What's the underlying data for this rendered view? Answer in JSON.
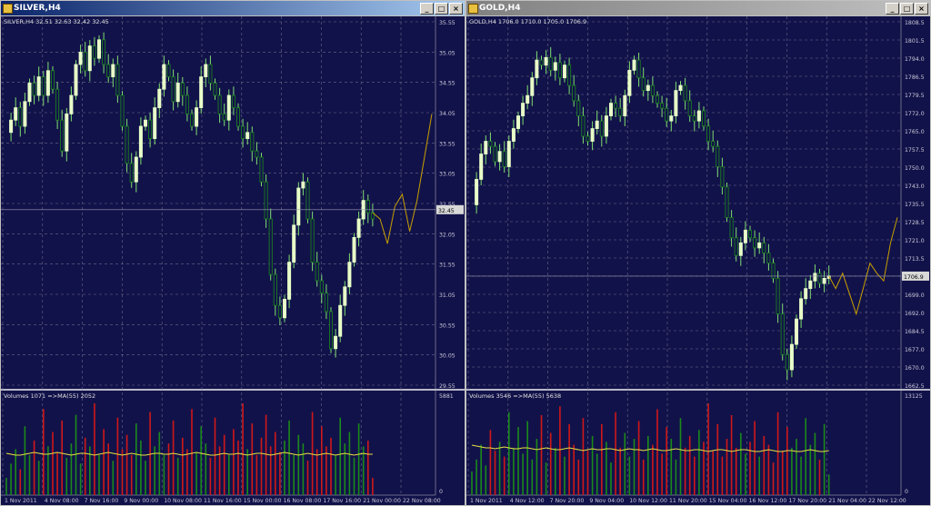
{
  "windows": [
    {
      "title": "SILVER,H4",
      "buttons": [
        "_",
        "□",
        "×"
      ],
      "info": "SILVER,H4  32.51 32.63 32.42 32.45",
      "price_label": "32.45",
      "volume_info": "Volumes 1071  =>MA(55) 2052",
      "volume_max_label": "5881",
      "volume_min_label": "0",
      "x_labels": [
        "1 Nov 2011",
        "4 Nov 08:00",
        "7 Nov 16:00",
        "9 Nov 00:00",
        "10 Nov 08:00",
        "11 Nov 16:00",
        "15 Nov 00:00",
        "16 Nov 08:00",
        "17 Nov 16:00",
        "21 Nov 00:00",
        "22 Nov 08:00"
      ],
      "y_labels": [
        "35.55",
        "35.05",
        "34.55",
        "34.05",
        "33.55",
        "33.05",
        "32.55",
        "32.05",
        "31.55",
        "31.05",
        "30.55",
        "30.05",
        "29.55"
      ]
    },
    {
      "title": "GOLD,H4",
      "buttons": [
        "_",
        "□",
        "×"
      ],
      "info": "GOLD,H4  1706.0 1710.0 1705.0 1706.9",
      "price_label": "1706.9",
      "volume_info": "Volumes 3546  =>MA(55) 5638",
      "volume_max_label": "13125",
      "volume_min_label": "0",
      "x_labels": [
        "1 Nov 2011",
        "4 Nov 12:00",
        "7 Nov 20:00",
        "9 Nov 04:00",
        "10 Nov 12:00",
        "11 Nov 20:00",
        "15 Nov 04:00",
        "16 Nov 12:00",
        "17 Nov 20:00",
        "21 Nov 04:00",
        "22 Nov 12:00"
      ],
      "y_labels": [
        "1808.5",
        "1801.5",
        "1794.0",
        "1786.5",
        "1779.5",
        "1772.0",
        "1765.0",
        "1757.5",
        "1750.0",
        "1743.0",
        "1735.5",
        "1728.5",
        "1721.0",
        "1713.5",
        "1706.5",
        "1699.0",
        "1692.0",
        "1684.5",
        "1677.0",
        "1670.0",
        "1662.5"
      ]
    }
  ],
  "colors": {
    "background": "#12124a",
    "grid": "#6a6a8a",
    "bull": "#e8ffc8",
    "bear": "#1a8a1a",
    "wick": "#7fdf6f",
    "forecast": "#c8a000",
    "vol_up": "#1a8a1a",
    "vol_down": "#d01818",
    "ma": "#e8e040",
    "text": "#c8c8d8"
  },
  "chart_data": [
    {
      "type": "candlestick",
      "title": "SILVER,H4",
      "ylim": [
        29.55,
        35.55
      ],
      "close_path": [
        33.7,
        33.9,
        34.1,
        33.8,
        34.2,
        34.5,
        34.3,
        34.6,
        34.3,
        34.7,
        34.4,
        33.9,
        33.4,
        34.0,
        34.3,
        34.8,
        35.0,
        34.7,
        35.1,
        34.9,
        35.2,
        34.8,
        34.6,
        34.8,
        34.3,
        33.8,
        33.2,
        32.9,
        33.3,
        33.8,
        33.9,
        33.6,
        34.1,
        34.4,
        34.8,
        34.6,
        34.2,
        34.5,
        34.3,
        34.0,
        33.8,
        34.1,
        34.6,
        34.8,
        34.5,
        34.3,
        34.0,
        33.9,
        34.3,
        34.1,
        33.8,
        33.6,
        33.7,
        33.4,
        33.3,
        32.9,
        32.3,
        31.4,
        30.9,
        30.7,
        31.0,
        31.6,
        32.2,
        32.8,
        32.9,
        32.3,
        31.6,
        31.3,
        31.1,
        30.8,
        30.2,
        30.4,
        30.9,
        31.2,
        31.6,
        32.0,
        32.3,
        32.6,
        32.4,
        32.3
      ],
      "forecast_path": [
        32.4,
        32.3,
        31.9,
        32.5,
        32.7,
        32.1,
        32.6,
        33.3,
        34.0
      ],
      "volumes": [
        30,
        55,
        80,
        45,
        120,
        70,
        95,
        60,
        150,
        85,
        110,
        75,
        130,
        65,
        90,
        140,
        55,
        100,
        85,
        160,
        70,
        115,
        90,
        60,
        135,
        80,
        105,
        70,
        125,
        95,
        60,
        145,
        85,
        110,
        70,
        90,
        130,
        65,
        100,
        80,
        150,
        75,
        120,
        90,
        65,
        135,
        85,
        105,
        70,
        115,
        95,
        160,
        80,
        125,
        70,
        100,
        140,
        85,
        110,
        75,
        95,
        130,
        70,
        105,
        90,
        60,
        145,
        80,
        120,
        85,
        100,
        70,
        135,
        90,
        110,
        65,
        125,
        85,
        95,
        30
      ],
      "ma_level": [
        46,
        45,
        44,
        44,
        45,
        46,
        47,
        46,
        45,
        45,
        46,
        47,
        46,
        45,
        44,
        45,
        46,
        46,
        45,
        44,
        45,
        46,
        47,
        46,
        45,
        44,
        45,
        46,
        45,
        44,
        44,
        45,
        46,
        46,
        45,
        45,
        46,
        45,
        44,
        45,
        46,
        47,
        46,
        45,
        44,
        44,
        45,
        46,
        45,
        45,
        46,
        45,
        44,
        45,
        46,
        46,
        45,
        44,
        45,
        46,
        47,
        46,
        45,
        44,
        45,
        46,
        45,
        44,
        45,
        46,
        45,
        44,
        45,
        46,
        45,
        44,
        45,
        46,
        45,
        45
      ],
      "vol_max": 5881
    },
    {
      "type": "candlestick",
      "title": "GOLD,H4",
      "ylim": [
        1662.5,
        1808.5
      ],
      "close_path": [
        1735,
        1745,
        1755,
        1760,
        1758,
        1752,
        1756,
        1750,
        1760,
        1765,
        1770,
        1775,
        1778,
        1785,
        1792,
        1790,
        1793,
        1788,
        1791,
        1785,
        1790,
        1782,
        1776,
        1770,
        1762,
        1760,
        1765,
        1768,
        1762,
        1770,
        1775,
        1773,
        1770,
        1778,
        1788,
        1792,
        1785,
        1780,
        1782,
        1778,
        1775,
        1773,
        1768,
        1770,
        1780,
        1782,
        1776,
        1770,
        1768,
        1772,
        1766,
        1760,
        1758,
        1750,
        1742,
        1730,
        1722,
        1715,
        1720,
        1725,
        1722,
        1718,
        1720,
        1716,
        1712,
        1706,
        1692,
        1676,
        1670,
        1680,
        1690,
        1698,
        1702,
        1705,
        1708,
        1704,
        1706,
        1707
      ],
      "forecast_path": [
        1706.9,
        1702,
        1708,
        1700,
        1692,
        1702,
        1712,
        1708,
        1705,
        1720,
        1730
      ],
      "volumes": [
        40,
        60,
        85,
        50,
        110,
        75,
        90,
        65,
        140,
        80,
        115,
        70,
        125,
        60,
        95,
        135,
        55,
        105,
        80,
        150,
        65,
        120,
        85,
        60,
        130,
        75,
        100,
        70,
        120,
        90,
        55,
        140,
        80,
        105,
        65,
        95,
        125,
        60,
        100,
        85,
        145,
        70,
        115,
        95,
        60,
        130,
        80,
        100,
        65,
        110,
        90,
        155,
        75,
        120,
        65,
        95,
        135,
        80,
        105,
        70,
        90,
        125,
        65,
        100,
        85,
        55,
        140,
        75,
        115,
        80,
        95,
        65,
        130,
        85,
        105,
        60,
        120,
        35
      ],
      "ma_level": [
        55,
        54,
        53,
        52,
        52,
        51,
        52,
        53,
        52,
        51,
        51,
        52,
        52,
        51,
        50,
        51,
        52,
        51,
        50,
        50,
        51,
        52,
        51,
        50,
        49,
        50,
        51,
        50,
        50,
        51,
        51,
        50,
        49,
        50,
        51,
        50,
        50,
        49,
        50,
        51,
        50,
        49,
        49,
        50,
        51,
        50,
        49,
        49,
        50,
        50,
        49,
        48,
        49,
        50,
        50,
        49,
        48,
        49,
        50,
        50,
        49,
        48,
        48,
        49,
        50,
        49,
        48,
        48,
        49,
        49,
        48,
        48,
        49,
        50,
        49,
        48,
        48,
        49
      ],
      "vol_max": 13125
    }
  ]
}
